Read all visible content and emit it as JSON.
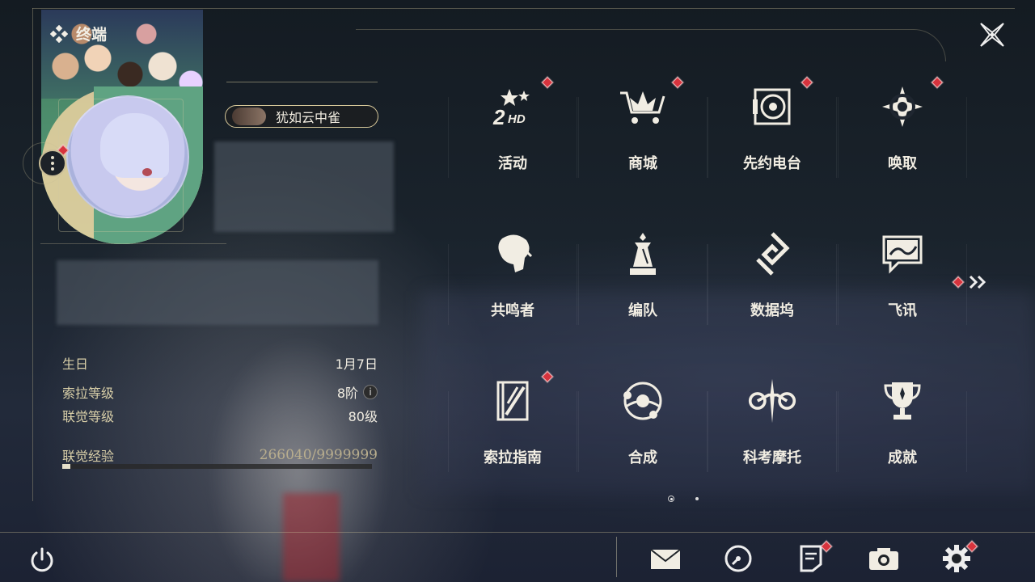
{
  "header": {
    "title": "终端"
  },
  "profile": {
    "name": "犹如云中雀"
  },
  "stats": {
    "birthday": {
      "label": "生日",
      "value": "1月7日"
    },
    "sora_level": {
      "label": "索拉等级",
      "value": "8阶"
    },
    "union_level": {
      "label": "联觉等级",
      "value": "80级"
    },
    "union_exp": {
      "label": "联觉经验",
      "value": "266040/9999999",
      "fraction": 0.027
    }
  },
  "menu": {
    "items": [
      {
        "label": "活动",
        "icon": "events-2hd-icon",
        "badge": true
      },
      {
        "label": "商城",
        "icon": "shop-cart-icon",
        "badge": true
      },
      {
        "label": "先约电台",
        "icon": "radio-player-icon",
        "badge": true
      },
      {
        "label": "唤取",
        "icon": "convene-compass-icon",
        "badge": true
      },
      {
        "label": "共鸣者",
        "icon": "resonator-portrait-icon",
        "badge": false
      },
      {
        "label": "编队",
        "icon": "team-chess-icon",
        "badge": false
      },
      {
        "label": "数据坞",
        "icon": "data-bank-icon",
        "badge": false
      },
      {
        "label": "飞讯",
        "icon": "message-chat-icon",
        "badge": false
      },
      {
        "label": "索拉指南",
        "icon": "guide-book-icon",
        "badge": true
      },
      {
        "label": "合成",
        "icon": "synthesis-orbit-icon",
        "badge": false
      },
      {
        "label": "科考摩托",
        "icon": "motorcycle-icon",
        "badge": false
      },
      {
        "label": "成就",
        "icon": "trophy-icon",
        "badge": false
      }
    ],
    "page_count": 2,
    "current_page": 1
  },
  "bottom_bar": {
    "buttons": [
      {
        "name": "mail",
        "icon": "mail-icon",
        "badge": false
      },
      {
        "name": "clock",
        "icon": "clock-icon",
        "badge": false
      },
      {
        "name": "notice",
        "icon": "notice-icon",
        "badge": true
      },
      {
        "name": "camera",
        "icon": "camera-icon",
        "badge": false
      },
      {
        "name": "settings",
        "icon": "gear-icon",
        "badge": true
      }
    ]
  },
  "colors": {
    "accent_gold": "#d8c99a",
    "badge_red": "#d7333d",
    "text_main": "#f1ede2",
    "label_gold": "#d9cfa8"
  }
}
